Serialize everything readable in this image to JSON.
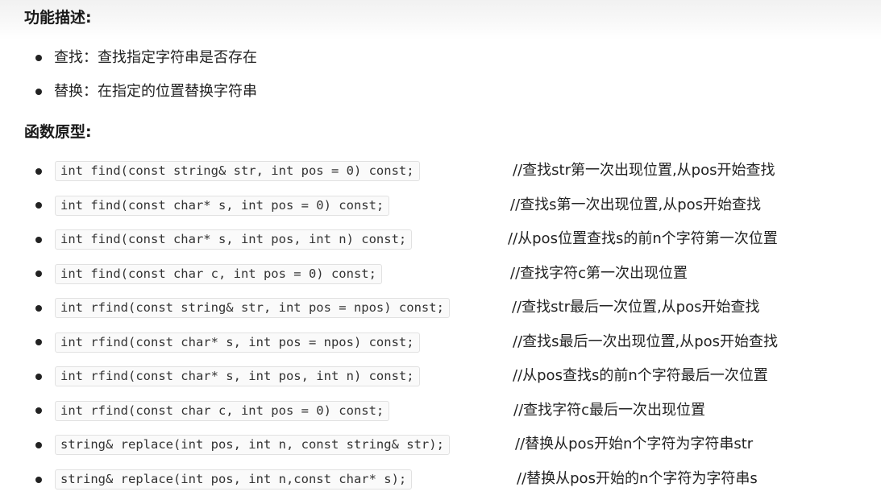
{
  "sections": {
    "description_heading": "功能描述:",
    "prototype_heading": "函数原型:"
  },
  "description_items": [
    "查找：查找指定字符串是否存在",
    "替换：在指定的位置替换字符串"
  ],
  "prototypes": [
    {
      "code": "int find(const string& str, int pos = 0) const;",
      "comment": "//查找str第一次出现位置,从pos开始查找"
    },
    {
      "code": "int find(const char* s, int pos = 0) const;",
      "comment": "//查找s第一次出现位置,从pos开始查找"
    },
    {
      "code": "int find(const char* s, int pos, int n) const;",
      "comment": "//从pos位置查找s的前n个字符第一次位置"
    },
    {
      "code": "int find(const char c, int pos = 0) const;",
      "comment": "//查找字符c第一次出现位置"
    },
    {
      "code": "int rfind(const string& str, int pos = npos) const;",
      "comment": "//查找str最后一次位置,从pos开始查找"
    },
    {
      "code": "int rfind(const char* s, int pos = npos) const;",
      "comment": "//查找s最后一次出现位置,从pos开始查找"
    },
    {
      "code": "int rfind(const char* s, int pos, int n) const;",
      "comment": "//从pos查找s的前n个字符最后一次位置"
    },
    {
      "code": "int rfind(const char c, int pos = 0) const;",
      "comment": "//查找字符c最后一次出现位置"
    },
    {
      "code": "string& replace(int pos, int n, const string& str);",
      "comment": "//替换从pos开始n个字符为字符串str"
    },
    {
      "code": "string& replace(int pos, int n,const char* s);",
      "comment": "//替换从pos开始的n个字符为字符串s"
    }
  ]
}
